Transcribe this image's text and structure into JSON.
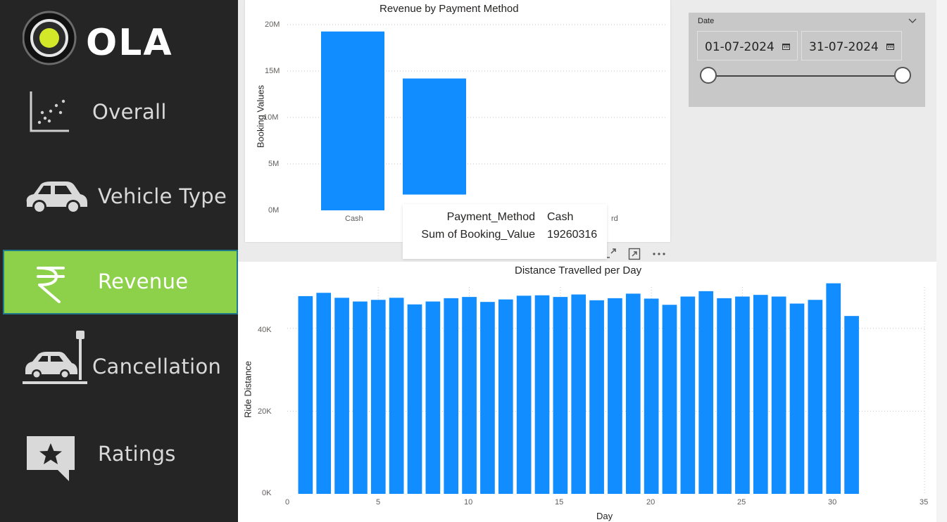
{
  "sidebar": {
    "logo_text": "OLA",
    "items": [
      {
        "label": "Overall",
        "icon": "scatter-chart-icon",
        "active": false
      },
      {
        "label": "Vehicle Type",
        "icon": "car-icon",
        "active": false
      },
      {
        "label": "Revenue",
        "icon": "rupee-icon",
        "active": true
      },
      {
        "label": "Cancellation",
        "icon": "car-crash-icon",
        "active": false
      },
      {
        "label": "Ratings",
        "icon": "star-speech-bubble-icon",
        "active": false
      }
    ],
    "colors": {
      "background": "#252525",
      "active": "#8dd14a",
      "text": "#d9d9d9"
    }
  },
  "top_chart": {
    "title": "Revenue by Payment Method",
    "ylabel": "Booking Values",
    "y_ticks": [
      "0M",
      "5M",
      "10M",
      "15M",
      "20M"
    ],
    "x_ticks": [
      "Cash",
      "rd"
    ]
  },
  "tooltip": {
    "rows": [
      {
        "label": "Payment_Method",
        "value": "Cash"
      },
      {
        "label": "Sum of Booking_Value",
        "value": "19260316"
      }
    ]
  },
  "visual_header": {
    "focus_icon": "focus-mode-icon",
    "expand_icon": "expand-icon",
    "more_icon": "more-options-icon"
  },
  "date_slicer": {
    "title": "Date",
    "start": "01-07-2024",
    "end": "31-07-2024",
    "range_fraction": [
      0,
      1
    ]
  },
  "bottom_chart": {
    "title": "Distance Travelled per Day",
    "xlabel": "Day",
    "ylabel": "Ride Distance",
    "x_ticks": [
      "0",
      "5",
      "10",
      "15",
      "20",
      "25",
      "30",
      "35"
    ],
    "y_ticks": [
      "0K",
      "20K",
      "40K"
    ]
  },
  "accent_color": "#118dff",
  "chart_data": [
    {
      "type": "bar",
      "title": "Revenue by Payment Method",
      "ylabel": "Booking Values",
      "categories": [
        "Cash",
        "",
        "",
        ""
      ],
      "bars": [
        {
          "bottom": 0,
          "top": 19260316
        },
        {
          "bottom": 1700000,
          "top": 14200000
        },
        {
          "bottom": 0,
          "top": 0
        },
        {
          "bottom": 0,
          "top": 300000
        }
      ],
      "ylim": [
        0,
        20000000
      ],
      "grid": true
    },
    {
      "type": "bar",
      "title": "Distance Travelled per Day",
      "xlabel": "Day",
      "ylabel": "Ride Distance",
      "x": [
        1,
        2,
        3,
        4,
        5,
        6,
        7,
        8,
        9,
        10,
        11,
        12,
        13,
        14,
        15,
        16,
        17,
        18,
        19,
        20,
        21,
        22,
        23,
        24,
        25,
        26,
        27,
        28,
        29,
        30,
        31
      ],
      "values": [
        47800,
        48600,
        47400,
        46500,
        46900,
        47400,
        45800,
        46500,
        47300,
        47600,
        46400,
        47000,
        47900,
        48000,
        47600,
        48200,
        46800,
        47300,
        48400,
        47200,
        45700,
        47700,
        49000,
        47300,
        47700,
        48100,
        47700,
        46000,
        46900,
        50900,
        43000
      ],
      "xlim": [
        0,
        35
      ],
      "ylim": [
        0,
        50000
      ],
      "grid": true
    }
  ]
}
